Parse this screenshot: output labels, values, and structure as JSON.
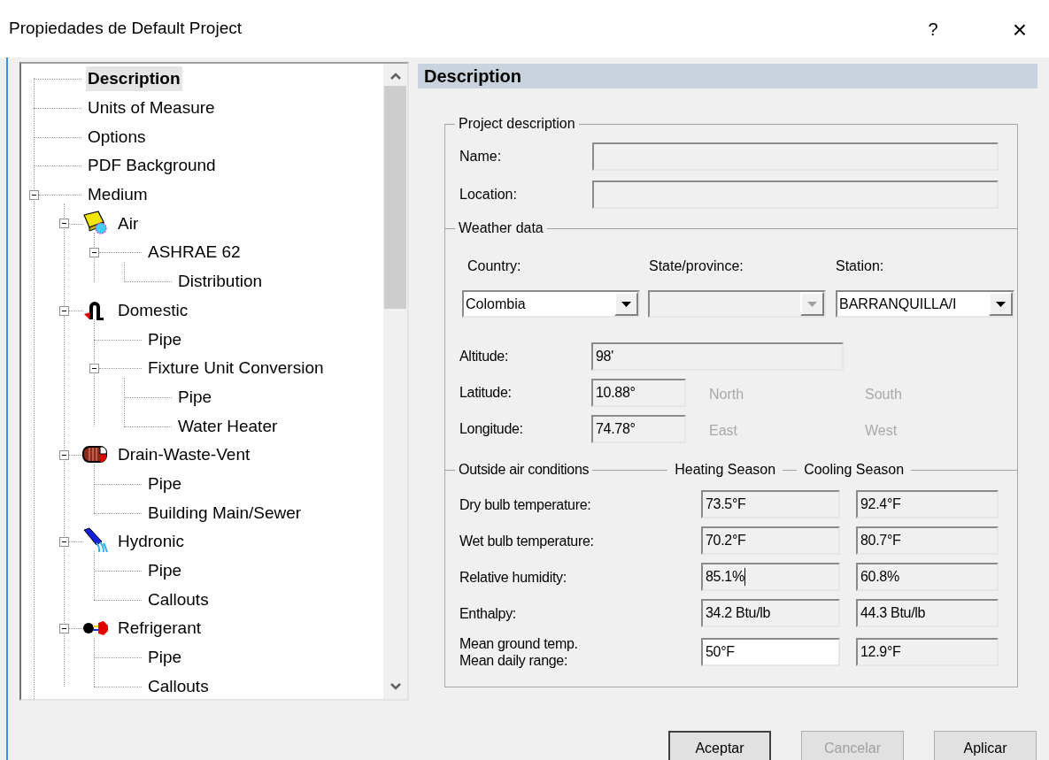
{
  "window": {
    "title": "Propiedades de Default Project",
    "help": "?",
    "close": "×"
  },
  "tree": [
    {
      "label": "Description",
      "kind": "plain",
      "selected": true
    },
    {
      "label": "Units of Measure",
      "kind": "plain",
      "selected": false
    },
    {
      "label": "Options",
      "kind": "plain",
      "selected": false
    },
    {
      "label": "PDF Background",
      "kind": "plain",
      "selected": false
    },
    {
      "label": "Medium",
      "kind": "plain",
      "selected": false,
      "expanded": true,
      "children": [
        {
          "label": "Air",
          "kind": "air",
          "selected": false,
          "expanded": true,
          "children": [
            {
              "label": "ASHRAE 62",
              "kind": "plain",
              "selected": false,
              "expanded": true,
              "children": [
                {
                  "label": "Distribution",
                  "kind": "plain",
                  "selected": false
                }
              ]
            }
          ]
        },
        {
          "label": "Domestic",
          "kind": "domestic",
          "selected": false,
          "expanded": true,
          "children": [
            {
              "label": "Pipe",
              "kind": "plain",
              "selected": false
            },
            {
              "label": "Fixture Unit Conversion",
              "kind": "plain",
              "selected": false,
              "expanded": true,
              "children": [
                {
                  "label": "Pipe",
                  "kind": "plain",
                  "selected": false
                },
                {
                  "label": "Water Heater",
                  "kind": "plain",
                  "selected": false
                }
              ]
            }
          ]
        },
        {
          "label": "Drain-Waste-Vent",
          "kind": "dwv",
          "selected": false,
          "expanded": true,
          "children": [
            {
              "label": "Pipe",
              "kind": "plain",
              "selected": false
            },
            {
              "label": "Building Main/Sewer",
              "kind": "plain",
              "selected": false
            }
          ]
        },
        {
          "label": "Hydronic",
          "kind": "hydronic",
          "selected": false,
          "expanded": true,
          "children": [
            {
              "label": "Pipe",
              "kind": "plain",
              "selected": false
            },
            {
              "label": "Callouts",
              "kind": "plain",
              "selected": false
            }
          ]
        },
        {
          "label": "Refrigerant",
          "kind": "refrigerant",
          "selected": false,
          "expanded": true,
          "children": [
            {
              "label": "Pipe",
              "kind": "plain",
              "selected": false
            },
            {
              "label": "Callouts",
              "kind": "plain",
              "selected": false
            }
          ]
        }
      ]
    }
  ],
  "panel": {
    "title": "Description"
  },
  "project_description": {
    "heading": "Project description",
    "fields": [
      {
        "label": "Name:",
        "editable": false
      },
      {
        "label": "Location:",
        "editable": false
      }
    ]
  },
  "weather_data": {
    "heading": "Weather data",
    "dropdowns": [
      {
        "label": "Country:",
        "value": "Colombia",
        "disabled": false
      },
      {
        "label": "State/province:",
        "disabled": true
      },
      {
        "label": "Station:",
        "value": "BARRANQUILLA/I",
        "disabled": false
      }
    ],
    "location_rows": [
      {
        "kind": "wide",
        "label": "Altitude:",
        "value": "98'",
        "editable": false
      },
      {
        "kind": "hemisphere",
        "label": "Latitude:",
        "value": "10.88°",
        "editable": false,
        "options": [
          {
            "label": "North",
            "disabled": true
          },
          {
            "label": "South",
            "disabled": true
          }
        ]
      },
      {
        "kind": "hemisphere",
        "label": "Longitude:",
        "value": "74.78°",
        "editable": false,
        "options": [
          {
            "label": "East",
            "disabled": true
          },
          {
            "label": "West",
            "disabled": true
          }
        ]
      }
    ]
  },
  "outside_air": {
    "heading": "Outside air conditions",
    "columns": [
      "Heating Season",
      "Cooling Season"
    ],
    "rows": [
      {
        "labels": [
          "Dry bulb temperature:"
        ],
        "values": [
          {
            "value": "73.5°F",
            "editable": false,
            "focused": false
          },
          {
            "value": "92.4°F",
            "editable": false,
            "focused": false
          }
        ]
      },
      {
        "labels": [
          "Wet bulb temperature:"
        ],
        "values": [
          {
            "value": "70.2°F",
            "editable": false,
            "focused": false
          },
          {
            "value": "80.7°F",
            "editable": false,
            "focused": false
          }
        ]
      },
      {
        "labels": [
          "Relative humidity:"
        ],
        "values": [
          {
            "value": "85.1%",
            "editable": false,
            "focused": true
          },
          {
            "value": "60.8%",
            "editable": false,
            "focused": false
          }
        ]
      },
      {
        "labels": [
          "Enthalpy:"
        ],
        "values": [
          {
            "value": "34.2 Btu/lb",
            "editable": false,
            "focused": false
          },
          {
            "value": "44.3 Btu/lb",
            "editable": false,
            "focused": false
          }
        ]
      },
      {
        "labels": [
          "Mean ground temp.",
          "Mean daily range:"
        ],
        "values": [
          {
            "value": "50°F",
            "editable": true,
            "focused": false
          },
          {
            "value": "12.9°F",
            "editable": false,
            "focused": false
          }
        ]
      }
    ]
  },
  "buttons": [
    {
      "label": "Aceptar",
      "disabled": false,
      "default": true
    },
    {
      "label": "Cancelar",
      "disabled": true,
      "default": false
    },
    {
      "label": "Aplicar",
      "disabled": false,
      "default": false
    }
  ]
}
